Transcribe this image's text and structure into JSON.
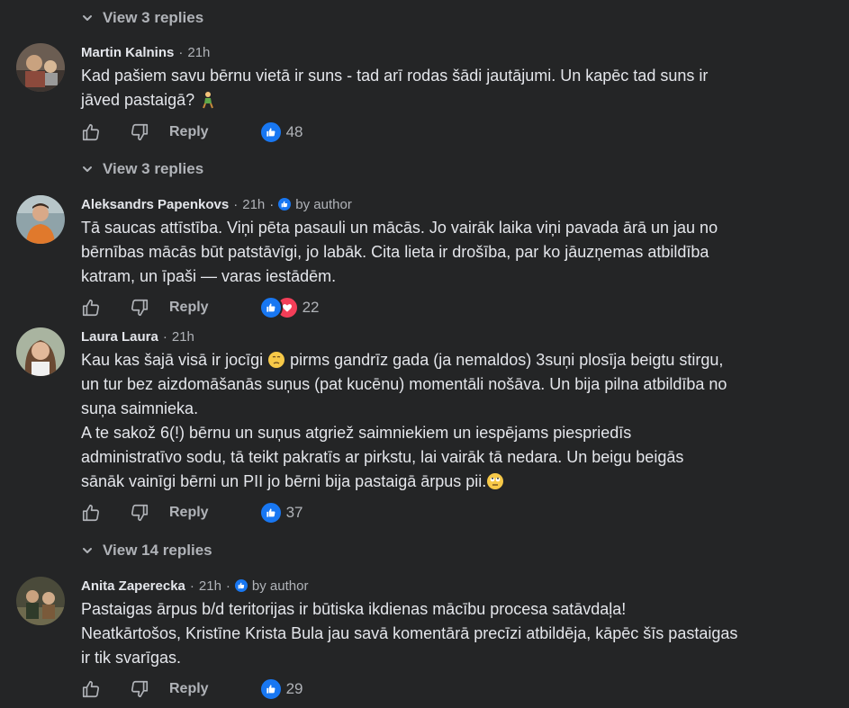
{
  "replies": {
    "top": "View 3 replies",
    "after_martin": "View 3 replies",
    "after_laura": "View 14 replies"
  },
  "reply_label": "Reply",
  "by_author_label": "by author",
  "comments": [
    {
      "author": "Martin Kalnins",
      "time": "21h",
      "lines": [
        "Kad pašiem savu bērnu vietā ir suns - tad arī rodas šādi jautājumi. Un kapēc tad suns ir",
        "jāved pastaigā?"
      ],
      "reaction_count": "48",
      "reactions": [
        "like"
      ]
    },
    {
      "author": "Aleksandrs Papenkovs",
      "time": "21h",
      "lines": [
        "Tā saucas attīstība. Viņi pēta pasauli un mācās. Jo vairāk laika viņi pavada ārā un jau no",
        "bērnības mācās būt patstāvīgi, jo labāk. Cita lieta ir drošība, par ko jāuzņemas atbildība",
        "katram, un īpaši — varas iestādēm."
      ],
      "reaction_count": "22",
      "reactions": [
        "like",
        "love"
      ]
    },
    {
      "author": "Laura Laura",
      "time": "21h",
      "lines": [
        "Kau kas šajā visā ir jocīgi",
        "pirms gandrīz gada (ja nemaldos) 3suņi plosīja beigtu stirgu,",
        "un tur bez aizdomāšanās suņus (pat kucēnu) momentāli nošāva. Un bija pilna atbildība no",
        "suņa saimnieka.",
        "A te sakož 6(!) bērnu un suņus atgriež saimniekiem un iespējams piespriedīs",
        "administratīvo sodu, tā teikt pakratīs ar pirkstu, lai vairāk tā nedara. Un beigu beigās",
        "sānāk vainīgi bērni un PII jo bērni bija pastaigā ārpus pii."
      ],
      "reaction_count": "37",
      "reactions": [
        "like"
      ]
    },
    {
      "author": "Anita Zaperecka",
      "time": "21h",
      "lines": [
        "Pastaigas ārpus b/d teritorijas ir būtiska ikdienas mācību procesa satāvdaļa!",
        "Neatkārtošos, Kristīne Krista Bula jau savā komentārā precīzi atbildēja, kāpēc šīs pastaigas",
        "ir tik svarīgas."
      ],
      "reaction_count": "29",
      "reactions": [
        "like"
      ]
    }
  ],
  "colors": {
    "background": "#242526",
    "text_primary": "#e4e6eb",
    "text_secondary": "#b0b3b8",
    "like_blue": "#1877f2",
    "love_red": "#f33e58"
  }
}
